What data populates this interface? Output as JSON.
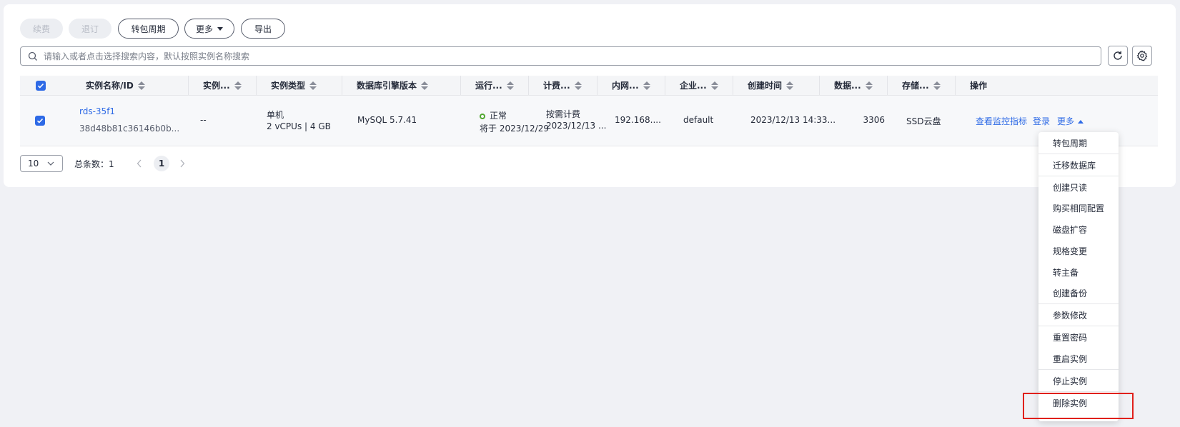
{
  "toolbar": {
    "renew_label": "续费",
    "unsubscribe_label": "退订",
    "to_subscription_label": "转包周期",
    "more_label": "更多",
    "export_label": "导出"
  },
  "search": {
    "placeholder": "请输入或者点击选择搜索内容，默认按照实例名称搜索"
  },
  "table": {
    "columns": [
      "实例名称/ID",
      "实例...",
      "实例类型",
      "数据库引擎版本",
      "运行...",
      "计费...",
      "内网...",
      "企业...",
      "创建时间",
      "数据...",
      "存储...",
      "操作"
    ],
    "rows": [
      {
        "name": "rds-35f1",
        "id": "38d48b81c36146b0b...",
        "description": "--",
        "type_line1": "单机",
        "type_line2": "2 vCPUs | 4 GB",
        "engine": "MySQL 5.7.41",
        "status": "正常",
        "status_sub": "将于 2023/12/29",
        "billing_line1": "按需计费",
        "billing_line2": "2023/12/13 ...",
        "private_ip": "192.168....",
        "enterprise_project": "default",
        "created": "2023/12/13 14:33...",
        "port": "3306",
        "storage": "SSD云盘",
        "action_monitor": "查看监控指标",
        "action_login": "登录",
        "action_more": "更多"
      }
    ]
  },
  "pagination": {
    "page_size": "10",
    "total_label": "总条数：",
    "total": "1",
    "current_page": "1"
  },
  "more_menu": {
    "items": [
      "转包周期",
      "迁移数据库",
      "创建只读",
      "购买相同配置",
      "磁盘扩容",
      "规格变更",
      "转主备",
      "创建备份",
      "参数修改",
      "重置密码",
      "重启实例",
      "停止实例",
      "删除实例"
    ],
    "highlighted_item": "删除实例"
  },
  "colors": {
    "primary": "#2e6ae6",
    "status_ok": "#50a72f",
    "highlight_border": "#e0201b"
  }
}
